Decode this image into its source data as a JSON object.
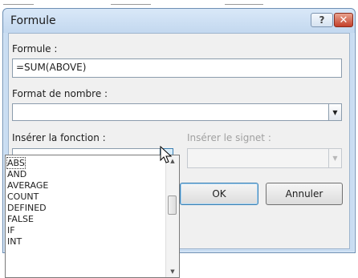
{
  "dialog": {
    "title": "Formule",
    "help_glyph": "?",
    "close_glyph": "✕"
  },
  "formula": {
    "label": "Formule :",
    "value": "=SUM(ABOVE)"
  },
  "number_format": {
    "label": "Format de nombre :",
    "value": ""
  },
  "insert_function": {
    "label": "Insérer la fonction :",
    "value": "",
    "options": [
      "ABS",
      "AND",
      "AVERAGE",
      "COUNT",
      "DEFINED",
      "FALSE",
      "IF",
      "INT"
    ],
    "selected": "ABS"
  },
  "insert_bookmark": {
    "label": "Insérer le signet :",
    "value": ""
  },
  "buttons": {
    "ok": "OK",
    "cancel": "Annuler"
  }
}
